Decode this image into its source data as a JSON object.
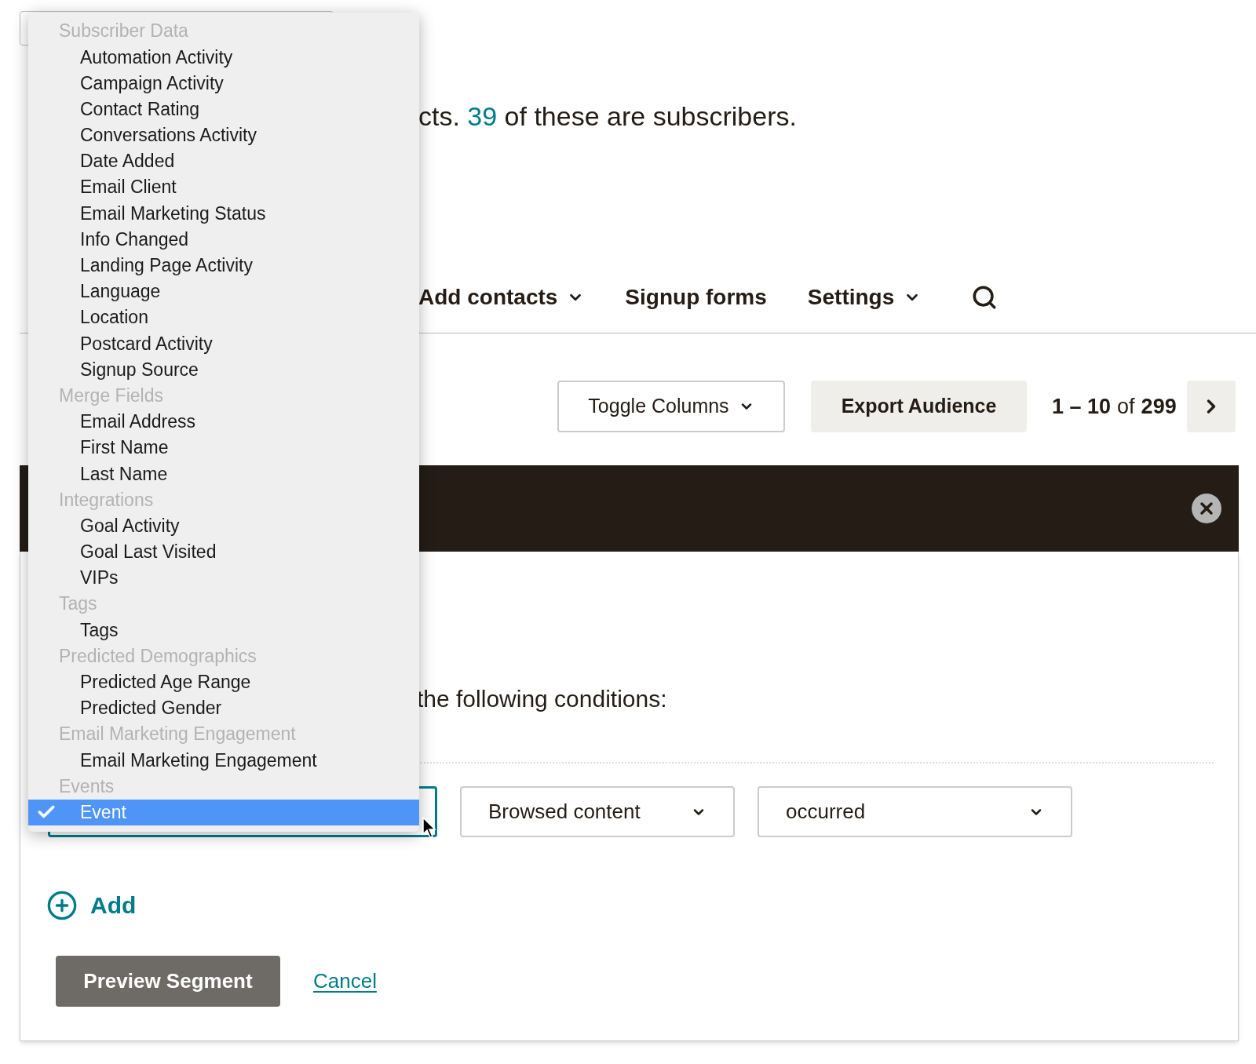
{
  "headline": {
    "end": "cts. **39** of these are subscribers."
  },
  "nav": {
    "items": [
      {
        "label": "Add contacts",
        "dropdown": true
      },
      {
        "label": "Signup forms",
        "dropdown": false
      },
      {
        "label": "Settings",
        "dropdown": true
      }
    ]
  },
  "toolbar": {
    "toggle": "Toggle Columns",
    "export": "Export Audience",
    "range": "1 – 10",
    "of": "of",
    "total": "299"
  },
  "segment": {
    "conditions_text": "the following conditions:",
    "field": "Browsed content",
    "operator": "occurred",
    "add": "Add",
    "preview": "Preview Segment",
    "cancel": "Cancel"
  },
  "menu": {
    "groups": [
      {
        "header": "Subscriber Data",
        "items": [
          {
            "label": "Automation Activity",
            "selected": false
          },
          {
            "label": "Campaign Activity",
            "selected": false
          },
          {
            "label": "Contact Rating",
            "selected": false
          },
          {
            "label": "Conversations Activity",
            "selected": false
          },
          {
            "label": "Date Added",
            "selected": false
          },
          {
            "label": "Email Client",
            "selected": false
          },
          {
            "label": "Email Marketing Status",
            "selected": false
          },
          {
            "label": "Info Changed",
            "selected": false
          },
          {
            "label": "Landing Page Activity",
            "selected": false
          },
          {
            "label": "Language",
            "selected": false
          },
          {
            "label": "Location",
            "selected": false
          },
          {
            "label": "Postcard Activity",
            "selected": false
          },
          {
            "label": "Signup Source",
            "selected": false
          }
        ]
      },
      {
        "header": "Merge Fields",
        "items": [
          {
            "label": "Email Address",
            "selected": false
          },
          {
            "label": "First Name",
            "selected": false
          },
          {
            "label": "Last Name",
            "selected": false
          }
        ]
      },
      {
        "header": "Integrations",
        "items": [
          {
            "label": "Goal Activity",
            "selected": false
          },
          {
            "label": "Goal Last Visited",
            "selected": false
          },
          {
            "label": "VIPs",
            "selected": false
          }
        ]
      },
      {
        "header": "Tags",
        "items": [
          {
            "label": "Tags",
            "selected": false
          }
        ]
      },
      {
        "header": "Predicted Demographics",
        "items": [
          {
            "label": "Predicted Age Range",
            "selected": false
          },
          {
            "label": "Predicted Gender",
            "selected": false
          }
        ]
      },
      {
        "header": "Email Marketing Engagement",
        "items": [
          {
            "label": "Email Marketing Engagement",
            "selected": false
          }
        ]
      },
      {
        "header": "Events",
        "items": [
          {
            "label": "Event",
            "selected": true
          }
        ]
      }
    ]
  }
}
